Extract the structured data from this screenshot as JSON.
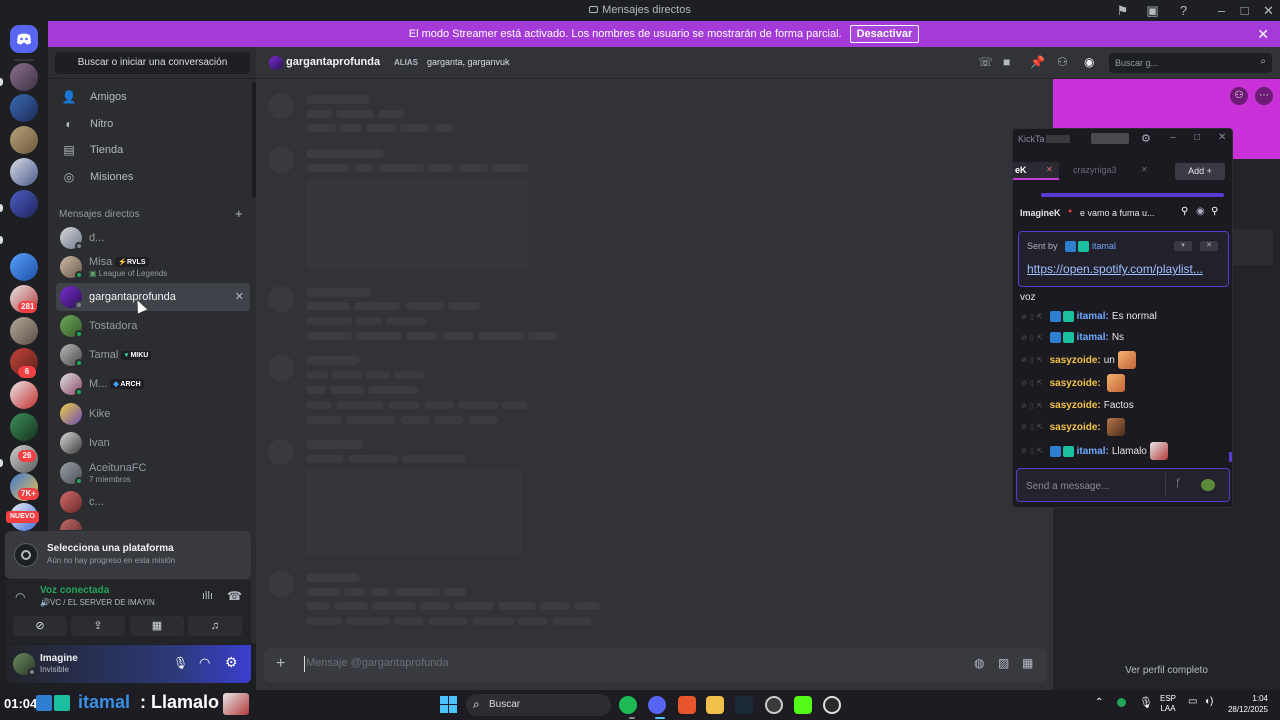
{
  "window": {
    "title": "Mensajes directos"
  },
  "banner": {
    "text": "El modo Streamer está activado. Los nombres de usuario se mostrarán de forma parcial.",
    "button": "Desactivar"
  },
  "rail": {
    "badges": [
      "281",
      "6",
      "26",
      "7K+",
      "NUEVO"
    ]
  },
  "sidebar": {
    "search_placeholder": "Buscar o iniciar una conversación",
    "nav": [
      {
        "label": "Amigos",
        "icon": "friends-icon"
      },
      {
        "label": "Nitro",
        "icon": "nitro-icon"
      },
      {
        "label": "Tienda",
        "icon": "shop-icon"
      },
      {
        "label": "Misiones",
        "icon": "quests-icon"
      }
    ],
    "dm_header": "Mensajes directos",
    "dms": [
      {
        "name": "d...",
        "sub": "",
        "tag": ""
      },
      {
        "name": "Misa",
        "sub": "League of Legends",
        "tag": "RVLS"
      },
      {
        "name": "gargantaprofunda",
        "sub": "",
        "tag": ""
      },
      {
        "name": "Tostadora",
        "sub": "",
        "tag": ""
      },
      {
        "name": "Tamal",
        "sub": "",
        "tag": "MIKU"
      },
      {
        "name": "M...",
        "sub": "",
        "tag": "ARCH"
      },
      {
        "name": "Kike",
        "sub": "",
        "tag": ""
      },
      {
        "name": "Ivan",
        "sub": "",
        "tag": ""
      },
      {
        "name": "AceitunaFC",
        "sub": "7 miembros",
        "tag": ""
      },
      {
        "name": "c...",
        "sub": "",
        "tag": ""
      }
    ]
  },
  "quest": {
    "title": "Selecciona una plataforma",
    "subtitle": "Aún no hay progreso en esta misión"
  },
  "voice": {
    "status": "Voz conectada",
    "channel": "VC / EL SERVER DE IMAYIN"
  },
  "user": {
    "name": "Imagine",
    "status": "Invisible"
  },
  "chat_header": {
    "name": "gargantaprofunda",
    "alias_label": "ALIAS",
    "alias": "garganta, garganvuk",
    "search_placeholder": "Buscar g..."
  },
  "composer": {
    "placeholder": "Mensaje @gargantaprofunda"
  },
  "profile_panel": {
    "view_profile": "Ver perfil completo"
  },
  "kicktalk": {
    "title": "KickTa",
    "tab_active": "eK",
    "tab_other": "crazyniga3",
    "add_label": "Add",
    "pinned_user": "ImagineK",
    "pinned_text": "e vamo a fuma u...",
    "sent_by_label": "Sent by",
    "sent_by_user": "itamal",
    "link": "https://open.spotify.com/playlist...",
    "voz": "voz",
    "messages": [
      {
        "user": "itamal:",
        "text": "Es normal",
        "emote": false,
        "kind": "u1"
      },
      {
        "user": "itamal:",
        "text": "Ns",
        "emote": false,
        "kind": "u1"
      },
      {
        "user": "sasyzoide:",
        "text": "un",
        "emote": true,
        "kind": "u2"
      },
      {
        "user": "sasyzoide:",
        "text": "",
        "emote": true,
        "kind": "u2"
      },
      {
        "user": "sasyzoide:",
        "text": "Factos",
        "emote": false,
        "kind": "u2"
      },
      {
        "user": "sasyzoide:",
        "text": "",
        "emote": true,
        "kind": "u2"
      },
      {
        "user": "itamal:",
        "text": "Llamalo",
        "emote": true,
        "kind": "u1"
      }
    ],
    "input_placeholder": "Send a message..."
  },
  "taskbar": {
    "clock_left": "01:04",
    "ticker_user": "itamal",
    "ticker_sep": ":",
    "ticker_text": "Llamalo",
    "search": "Buscar",
    "lang1": "ESP",
    "lang2": "LAA",
    "time": "1:04",
    "date": "28/12/2025"
  },
  "colors": {
    "banner": "#a43bd8",
    "accent": "#5865f2",
    "online": "#23a55a",
    "badge": "#f23f43"
  }
}
